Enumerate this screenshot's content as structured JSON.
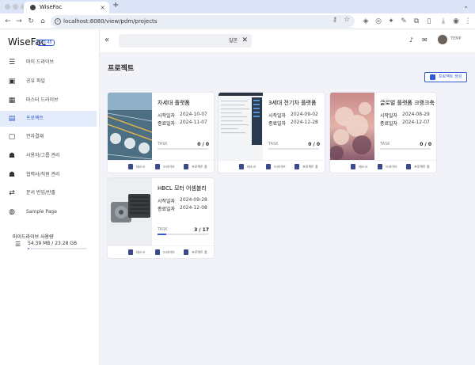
{
  "browser": {
    "tab_title": "WiseFac",
    "tab_close": "×",
    "new_tab": "+",
    "url": "localhost:8080/view/pdm/projects",
    "nav": {
      "back": "←",
      "forward": "→",
      "reload": "↻",
      "home": "⌂"
    }
  },
  "app": {
    "brand": "WiseFac",
    "version": "v 0.45"
  },
  "sidebar": {
    "items": [
      {
        "label": "마이 드라이브",
        "icon": "list-icon",
        "glyph": "☰"
      },
      {
        "label": "공유 파일",
        "icon": "shared-folder-icon",
        "glyph": "▣"
      },
      {
        "label": "마스터 드라이브",
        "icon": "grid-icon",
        "glyph": "▦"
      },
      {
        "label": "프로젝트",
        "icon": "project-icon",
        "glyph": "▤",
        "active": true
      },
      {
        "label": "전자결재",
        "icon": "approval-icon",
        "glyph": "▢"
      },
      {
        "label": "사용자/그룹 관리",
        "icon": "users-icon",
        "glyph": "☗"
      },
      {
        "label": "협력사/직원 관리",
        "icon": "partners-icon",
        "glyph": "☗"
      },
      {
        "label": "문서 반입/반출",
        "icon": "transfer-icon",
        "glyph": "⇄"
      },
      {
        "label": "Sample Page",
        "icon": "globe-icon",
        "glyph": "◍"
      }
    ],
    "drive": {
      "title": "마이드라이브 사용량",
      "usage": "54.39 MB / 23.28 GB",
      "fraction": 0.0023
    }
  },
  "header": {
    "search_keyword": "일본",
    "clear": "✕",
    "collapse": "«",
    "bell": "♪",
    "mail": "✉",
    "user": "TEMP"
  },
  "main": {
    "title": "프로젝트",
    "new_button": "프로젝트 생성",
    "date_start_label": "시작일자",
    "date_end_label": "종료일자",
    "task_label": "TASK",
    "footer": [
      "태스크",
      "드라이브",
      "프로젝트 홈"
    ],
    "projects": [
      {
        "name": "차세대 플랫폼",
        "start": "2024-10-07",
        "end": "2024-11-07",
        "task": "0 / 0",
        "progress": 0
      },
      {
        "name": "3세대 전기차 플랫폼",
        "start": "2024-09-02",
        "end": "2024-12-28",
        "task": "0 / 0",
        "progress": 0
      },
      {
        "name": "글로벌 플랫폼 크랭크축",
        "start": "2024-08-29",
        "end": "2024-12-07",
        "task": "0 / 0",
        "progress": 0
      },
      {
        "name": "HBCL 모터 어셈블리",
        "start": "2024-09-28",
        "end": "2024-12-08",
        "task": "3 / 17",
        "progress": 0.176
      }
    ]
  },
  "colors": {
    "accent": "#2f5bd3",
    "sidebar_active": "#e4ebfa",
    "content_bg": "#f1f3f8"
  }
}
